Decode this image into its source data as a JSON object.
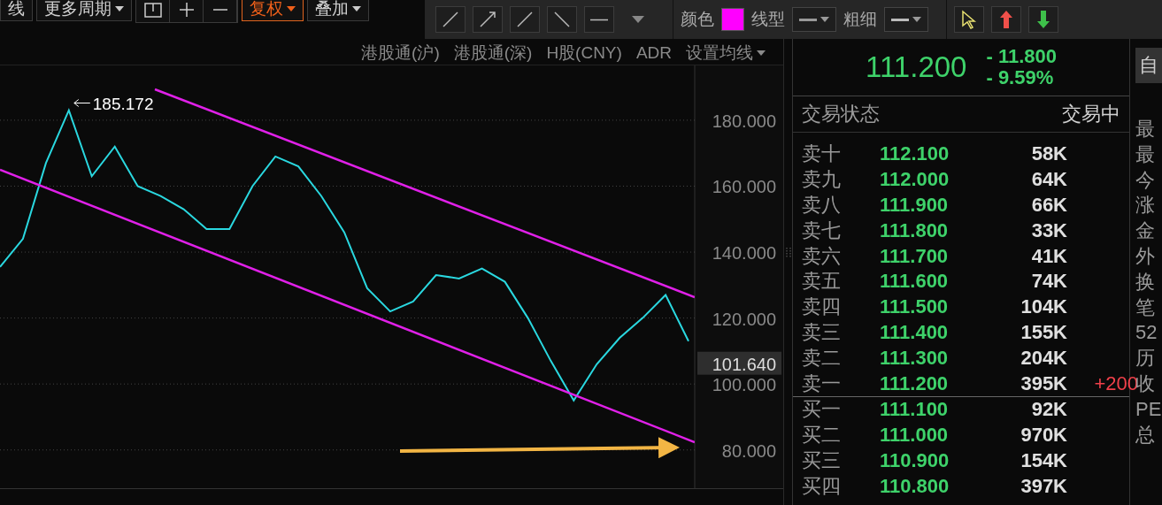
{
  "top_toolbar": [
    {
      "kind": "button",
      "label": "线",
      "dropdown": false,
      "selected": false
    },
    {
      "kind": "button",
      "label": "更多周期",
      "dropdown": true,
      "selected": false
    },
    {
      "kind": "icon_group"
    },
    {
      "kind": "button",
      "label": "复权",
      "dropdown": true,
      "selected": true
    },
    {
      "kind": "button",
      "label": "叠加",
      "dropdown": true,
      "selected": false
    }
  ],
  "drawing_toolbar": {
    "color_label": "颜色",
    "color": "#ff00ff",
    "style_label": "线型",
    "width_label": "粗细"
  },
  "links": [
    {
      "kind": "link",
      "label": "港股通(沪)"
    },
    {
      "kind": "link",
      "label": "港股通(深)"
    },
    {
      "kind": "link",
      "label": "H股(CNY)"
    },
    {
      "kind": "link",
      "label": "ADR"
    },
    {
      "kind": "dropdown",
      "label": "设置均线"
    }
  ],
  "chart": {
    "current_price_tag": "101.640",
    "chart_data": {
      "type": "line",
      "grid": true,
      "ylim": [
        68.4,
        196.6
      ],
      "yticks": [
        {
          "value": 180,
          "label": "180.000"
        },
        {
          "value": 160,
          "label": "160.000"
        },
        {
          "value": 140,
          "label": "140.000"
        },
        {
          "value": 120,
          "label": "120.000"
        },
        {
          "value": 100,
          "label": "100.000"
        },
        {
          "value": 80,
          "label": "80.000"
        }
      ],
      "series": [
        {
          "color": "#2ad8e0",
          "values": [
            135.5,
            144,
            167,
            183,
            163,
            172,
            160,
            157,
            153,
            147,
            147,
            160,
            169,
            166,
            157,
            146,
            129,
            122,
            125,
            133,
            132,
            135,
            131,
            120,
            107,
            95,
            106,
            114,
            120,
            127,
            113
          ]
        }
      ],
      "annotations": [
        {
          "text": "185.172"
        }
      ]
    }
  },
  "quote": {
    "price": "111.200",
    "change": "- 11.800",
    "change_pct": "- 9.59%",
    "side_button": "自",
    "status_label": "交易状态",
    "status_value": "交易中"
  },
  "order_book": {
    "sell": [
      {
        "label": "卖十",
        "price": "112.100",
        "volume": "58K"
      },
      {
        "label": "卖九",
        "price": "112.000",
        "volume": "64K"
      },
      {
        "label": "卖八",
        "price": "111.900",
        "volume": "66K"
      },
      {
        "label": "卖七",
        "price": "111.800",
        "volume": "33K"
      },
      {
        "label": "卖六",
        "price": "111.700",
        "volume": "41K"
      },
      {
        "label": "卖五",
        "price": "111.600",
        "volume": "74K"
      },
      {
        "label": "卖四",
        "price": "111.500",
        "volume": "104K"
      },
      {
        "label": "卖三",
        "price": "111.400",
        "volume": "155K"
      },
      {
        "label": "卖二",
        "price": "111.300",
        "volume": "204K"
      },
      {
        "label": "卖一",
        "price": "111.200",
        "volume": "395K",
        "delta": "+200"
      }
    ],
    "buy": [
      {
        "label": "买一",
        "price": "111.100",
        "volume": "92K"
      },
      {
        "label": "买二",
        "price": "111.000",
        "volume": "970K"
      },
      {
        "label": "买三",
        "price": "110.900",
        "volume": "154K"
      },
      {
        "label": "买四",
        "price": "110.800",
        "volume": "397K"
      }
    ]
  },
  "side_labels": [
    "最",
    "最",
    "今",
    "涨",
    "金",
    "外",
    "换",
    "笔",
    "52",
    "历",
    "收",
    "PE",
    "总"
  ]
}
